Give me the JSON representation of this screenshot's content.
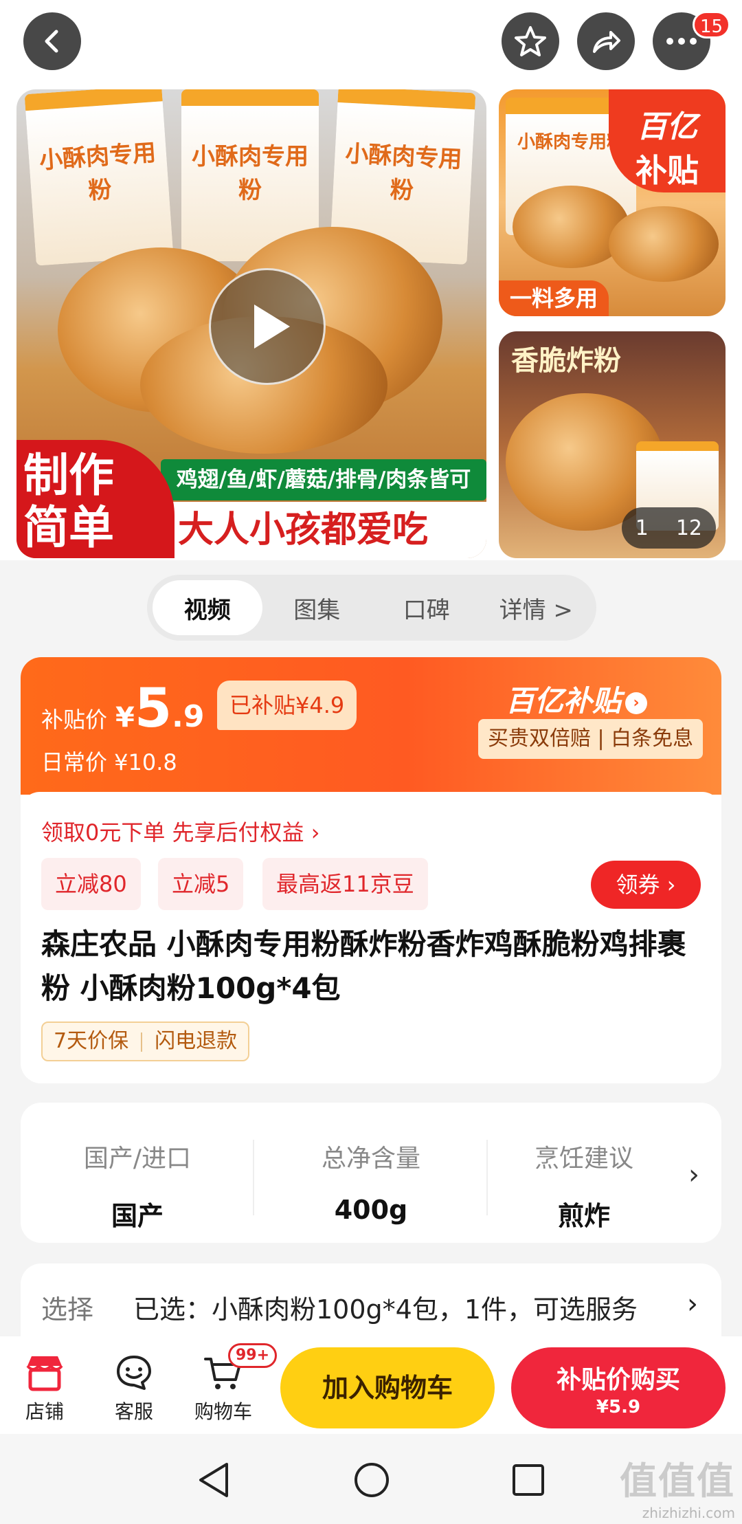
{
  "top": {
    "notifications": "15"
  },
  "gallery": {
    "bag_title": "小酥肉专用粉",
    "bag_title_short": "小酥肉专用粉",
    "banner_green": "鸡翅/鱼/虾/蘑菇/排骨/肉条皆可",
    "banner_white": "大人小孩都爱吃",
    "badge_left_line1": "制作",
    "badge_left_line2": "简单",
    "yi_badge_l1": "百亿",
    "yi_badge_l2": "补贴",
    "side1_tag": "一料多用",
    "side2_title": "香脆炸粉",
    "counter_current": "1",
    "counter_total": "12"
  },
  "tabs": [
    "视频",
    "图集",
    "口碑",
    "详情 >"
  ],
  "price": {
    "subsidy_label": "补贴价",
    "currency": "¥",
    "int_part": "5",
    "dec_part": ".9",
    "already_subsidized": "已补贴¥4.9",
    "daily_price": "日常价 ¥10.8",
    "yi_logo": "百亿补贴",
    "yi_tags": "买贵双倍赔 | 白条免息"
  },
  "offers": {
    "pay_later": "领取0元下单 先享后付权益 ›",
    "coupons": [
      "立减80",
      "立减5",
      "最高返11京豆"
    ],
    "get_coupon": "领券"
  },
  "product": {
    "title": "森庄农品 小酥肉专用粉酥炸粉香炸鸡酥脆粉鸡排裹粉 小酥肉粉100g*4包",
    "guarantee1": "7天价保",
    "guarantee2": "闪电退款"
  },
  "specs": [
    {
      "k": "国产/进口",
      "v": "国产"
    },
    {
      "k": "总净含量",
      "v": "400g"
    },
    {
      "k": "烹饪建议",
      "v": "煎炸"
    }
  ],
  "select": {
    "label": "选择",
    "value": "已选：小酥肉粉100g*4包，1件，可选服务"
  },
  "bar": {
    "store": "店铺",
    "service": "客服",
    "cart": "购物车",
    "cart_badge": "99+",
    "add_cart": "加入购物车",
    "buy_l1": "补贴价购买",
    "buy_l2": "¥5.9"
  },
  "watermark": {
    "big": "值值值",
    "small": "zhizhizhi.com"
  },
  "colors": {
    "accent_red": "#f0263c",
    "accent_orange": "#ff5a22",
    "cart_yellow": "#ffcf12"
  }
}
